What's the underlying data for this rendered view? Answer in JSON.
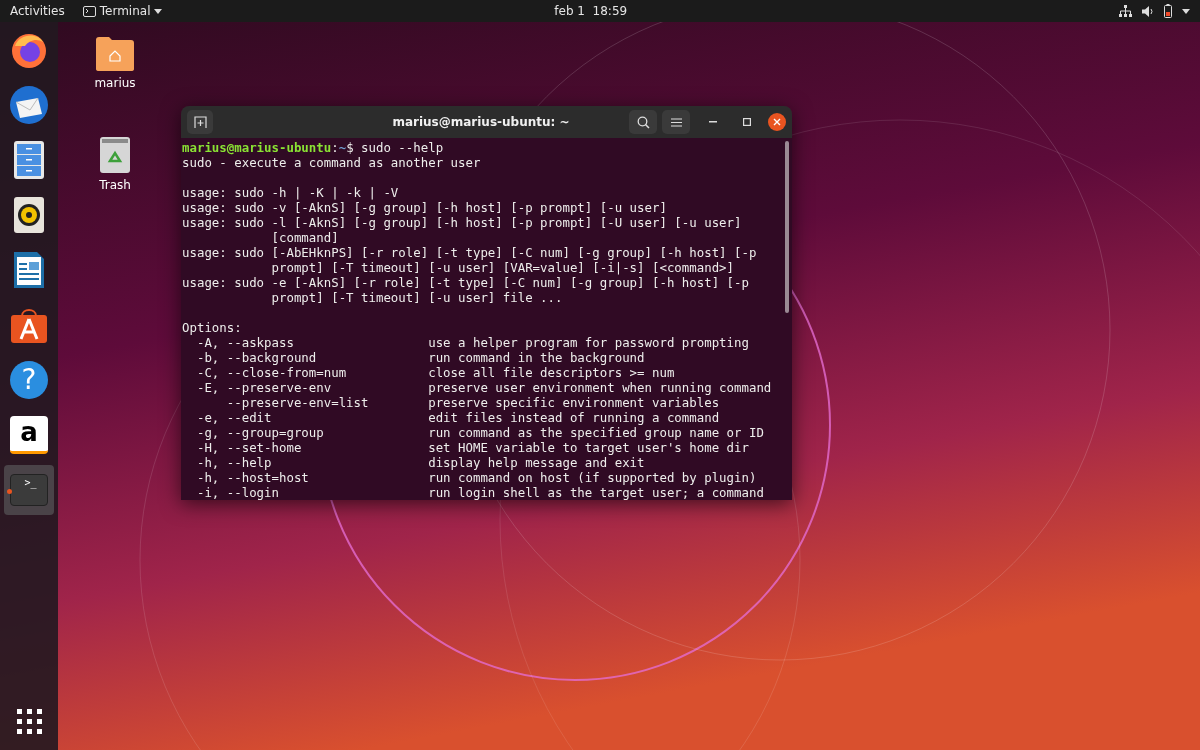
{
  "top_bar": {
    "activities": "Activities",
    "app_menu": "Terminal",
    "clock": "feb 1  18:59"
  },
  "dock": {
    "items": [
      {
        "kind": "browser",
        "selected": false,
        "running": false
      },
      {
        "kind": "mail",
        "selected": false,
        "running": false
      },
      {
        "kind": "files",
        "selected": false,
        "running": false
      },
      {
        "kind": "music",
        "selected": false,
        "running": false
      },
      {
        "kind": "writer",
        "selected": false,
        "running": false
      },
      {
        "kind": "software",
        "selected": false,
        "running": false
      },
      {
        "kind": "help",
        "glyph": "?",
        "selected": false,
        "running": false
      },
      {
        "kind": "store",
        "glyph": "a",
        "selected": false,
        "running": false
      },
      {
        "kind": "terminal",
        "glyph": ">_",
        "selected": true,
        "running": true
      }
    ]
  },
  "desktop_icons": [
    {
      "kind": "folder",
      "label": "marius"
    },
    {
      "kind": "trash",
      "label": "Trash"
    }
  ],
  "terminal": {
    "title": "marius@marius-ubuntu: ~",
    "prompt": {
      "user_host": "marius@marius-ubuntu",
      "separator": ":",
      "path": "~",
      "symbol": "$",
      "command": "sudo --help"
    },
    "paragraphs": [
      [
        "sudo - execute a command as another user"
      ],
      [
        "usage: sudo -h | -K | -k | -V",
        "usage: sudo -v [-AknS] [-g group] [-h host] [-p prompt] [-u user]",
        "usage: sudo -l [-AknS] [-g group] [-h host] [-p prompt] [-U user] [-u user]",
        "            [command]",
        "usage: sudo [-AbEHknPS] [-r role] [-t type] [-C num] [-g group] [-h host] [-p",
        "            prompt] [-T timeout] [-u user] [VAR=value] [-i|-s] [<command>]",
        "usage: sudo -e [-AknS] [-r role] [-t type] [-C num] [-g group] [-h host] [-p",
        "            prompt] [-T timeout] [-u user] file ..."
      ],
      [
        "Options:"
      ]
    ],
    "options": [
      {
        "flag": "  -A, --askpass",
        "description": "use a helper program for password prompting"
      },
      {
        "flag": "  -b, --background",
        "description": "run command in the background"
      },
      {
        "flag": "  -C, --close-from=num",
        "description": "close all file descriptors >= num"
      },
      {
        "flag": "  -E, --preserve-env",
        "description": "preserve user environment when running command"
      },
      {
        "flag": "      --preserve-env=list",
        "description": "preserve specific environment variables"
      },
      {
        "flag": "  -e, --edit",
        "description": "edit files instead of running a command"
      },
      {
        "flag": "  -g, --group=group",
        "description": "run command as the specified group name or ID"
      },
      {
        "flag": "  -H, --set-home",
        "description": "set HOME variable to target user's home dir"
      },
      {
        "flag": "  -h, --help",
        "description": "display help message and exit"
      },
      {
        "flag": "  -h, --host=host",
        "description": "run command on host (if supported by plugin)"
      },
      {
        "flag": "  -i, --login",
        "description": "run login shell as the target user; a command"
      }
    ]
  }
}
